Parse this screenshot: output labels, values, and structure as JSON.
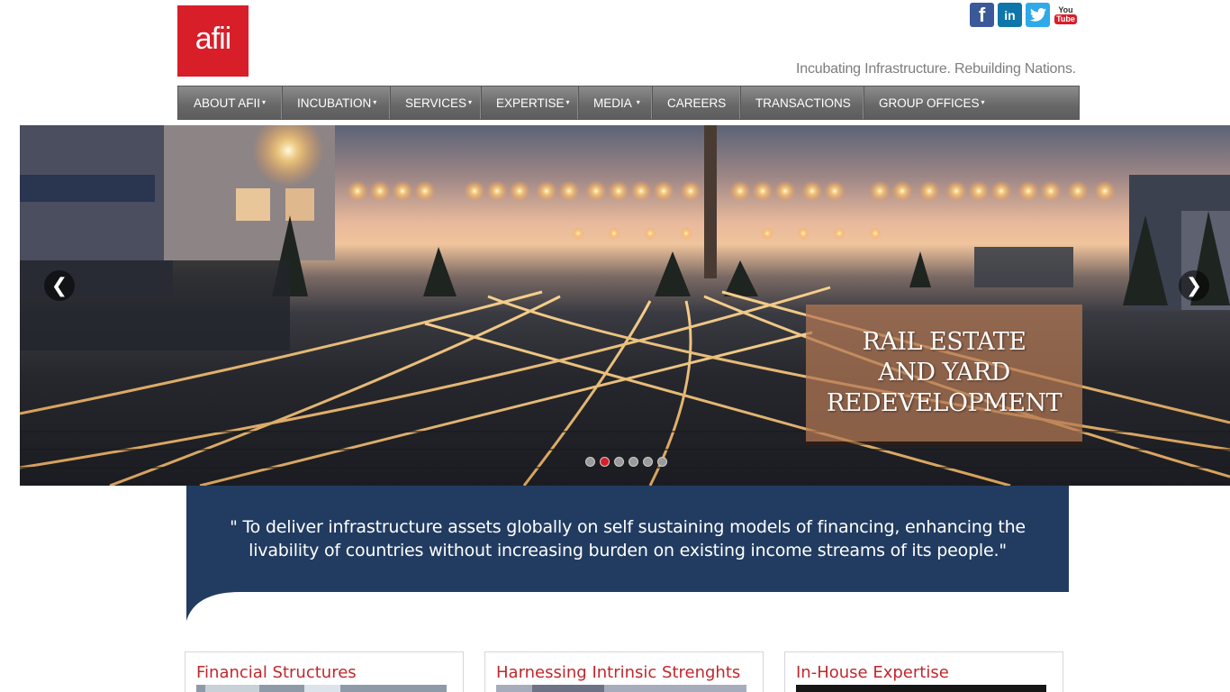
{
  "header": {
    "logo_text": "afii",
    "tagline": "Incubating Infrastructure. Rebuilding Nations."
  },
  "social": [
    {
      "name": "facebook",
      "icon": "facebook-icon",
      "glyph": "f"
    },
    {
      "name": "linkedin",
      "icon": "linkedin-icon",
      "glyph": "in"
    },
    {
      "name": "twitter",
      "icon": "twitter-icon"
    },
    {
      "name": "youtube",
      "icon": "youtube-icon",
      "glyph_top": "You",
      "glyph_bottom": "Tube"
    }
  ],
  "nav": {
    "items": [
      {
        "label": "ABOUT AFII",
        "dropdown": true
      },
      {
        "label": "INCUBATION",
        "dropdown": true
      },
      {
        "label": "SERVICES",
        "dropdown": true
      },
      {
        "label": "EXPERTISE",
        "dropdown": true
      },
      {
        "label": "MEDIA",
        "dropdown": true
      },
      {
        "label": "CAREERS",
        "dropdown": false
      },
      {
        "label": "TRANSACTIONS",
        "dropdown": false
      },
      {
        "label": "GROUP OFFICES",
        "dropdown": true
      }
    ],
    "caret": "▾"
  },
  "hero": {
    "caption": "RAIL ESTATE\nAND YARD\nREDEVELOPMENT",
    "prev_glyph": "❮",
    "next_glyph": "❯",
    "slide_count": 6,
    "active_slide": 2
  },
  "quote": {
    "text": "\" To deliver infrastructure assets globally on self sustaining models of financing, enhancing the livability of countries without increasing burden on existing income streams of its people.\""
  },
  "cards": [
    {
      "title": "Financial Structures"
    },
    {
      "title": "Harnessing Intrinsic Strenghts"
    },
    {
      "title": "In-House Expertise"
    }
  ],
  "colors": {
    "brand_red": "#d81e29",
    "navy": "#223c61",
    "card_title": "#c0272d"
  }
}
